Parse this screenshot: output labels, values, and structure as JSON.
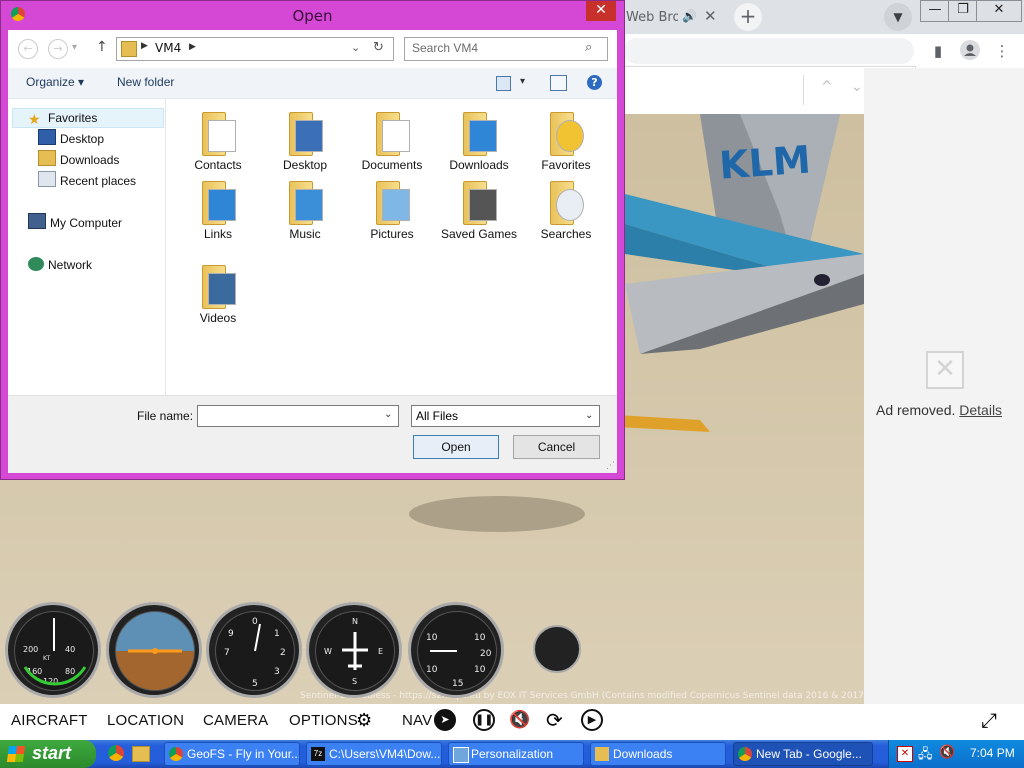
{
  "browser": {
    "tab_partial": "Web Bro",
    "new_tab_symbol": "+",
    "find_prev": "^",
    "find_next": "⌄",
    "find_close": "✕"
  },
  "ad": {
    "text": "Ad removed.",
    "details": "Details"
  },
  "game": {
    "nav": [
      "AIRCRAFT",
      "LOCATION",
      "CAMERA",
      "OPTIONS",
      "NAV"
    ],
    "tail_text": "KLM",
    "attribution": "Sentinel-2 cloudless - https://s2maps.eu by EOX IT Services GmbH (Contains modified Copernicus Sentinel data 2016 & 2017)"
  },
  "dialog": {
    "title": "Open",
    "path_segments": [
      "VM4"
    ],
    "search_placeholder": "Search VM4",
    "organize": "Organize",
    "new_folder": "New folder",
    "nav_items": {
      "favorites": "Favorites",
      "desktop": "Desktop",
      "downloads": "Downloads",
      "recent": "Recent places",
      "computer": "My Computer",
      "network": "Network"
    },
    "folders": [
      "Contacts",
      "Desktop",
      "Documents",
      "Downloads",
      "Favorites",
      "Links",
      "Music",
      "Pictures",
      "Saved Games",
      "Searches",
      "Videos"
    ],
    "file_name_label": "File name:",
    "file_name_value": "",
    "file_type": "All Files",
    "open_button": "Open",
    "cancel_button": "Cancel"
  },
  "taskbar": {
    "start": "start",
    "items": [
      "GeoFS - Fly in Your...",
      "C:\\Users\\VM4\\Dow...",
      "Personalization",
      "Downloads",
      "New Tab - Google..."
    ],
    "clock": "7:04 PM"
  },
  "colors": {
    "dialog_frame": "#d548d5",
    "taskbar": "#245edb",
    "start": "#3ea93e"
  }
}
